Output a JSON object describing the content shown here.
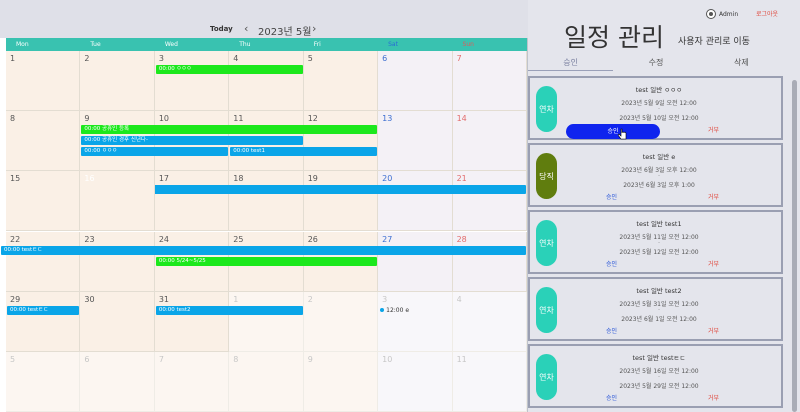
{
  "calendar": {
    "today_label": "Today",
    "prev_icon": "chevron-left",
    "next_icon": "chevron-right",
    "month_title": "2023년 5월",
    "weekdays": [
      "Mon",
      "Tue",
      "Wed",
      "Thu",
      "Fri",
      "Sat",
      "Sun"
    ],
    "weeks": [
      [
        {
          "d": "1"
        },
        {
          "d": "2"
        },
        {
          "d": "3"
        },
        {
          "d": "4"
        },
        {
          "d": "5"
        },
        {
          "d": "6"
        },
        {
          "d": "7"
        }
      ],
      [
        {
          "d": "8"
        },
        {
          "d": "9"
        },
        {
          "d": "10"
        },
        {
          "d": "11"
        },
        {
          "d": "12"
        },
        {
          "d": "13"
        },
        {
          "d": "14"
        }
      ],
      [
        {
          "d": "15"
        },
        {
          "d": "16"
        },
        {
          "d": "17"
        },
        {
          "d": "18"
        },
        {
          "d": "19"
        },
        {
          "d": "20"
        },
        {
          "d": "21"
        }
      ],
      [
        {
          "d": "22"
        },
        {
          "d": "23"
        },
        {
          "d": "24"
        },
        {
          "d": "25"
        },
        {
          "d": "26"
        },
        {
          "d": "27"
        },
        {
          "d": "28"
        }
      ],
      [
        {
          "d": "29"
        },
        {
          "d": "30"
        },
        {
          "d": "31"
        },
        {
          "d": "1",
          "other": true
        },
        {
          "d": "2",
          "other": true
        },
        {
          "d": "3",
          "other": true
        },
        {
          "d": "4",
          "other": true
        }
      ],
      [
        {
          "d": "5",
          "other": true
        },
        {
          "d": "6",
          "other": true
        },
        {
          "d": "7",
          "other": true
        },
        {
          "d": "8",
          "other": true
        },
        {
          "d": "9",
          "other": true
        },
        {
          "d": "10",
          "other": true
        },
        {
          "d": "11",
          "other": true
        }
      ]
    ],
    "today_date": "16",
    "events": [
      {
        "week": 0,
        "col": 2,
        "span": 2,
        "row": 0,
        "color": "green",
        "text": "00:00 ㅇㅇㅇ"
      },
      {
        "week": 1,
        "col": 1,
        "span": 4,
        "row": 0,
        "color": "green",
        "text": "00:00 공휴인 등록"
      },
      {
        "week": 1,
        "col": 1,
        "span": 3,
        "row": 1,
        "color": "blue",
        "text": "00:00 공휴인 경후 신년다-"
      },
      {
        "week": 1,
        "col": 1,
        "span": 2,
        "row": 2,
        "color": "blue",
        "text": "00:00 ㅇㅇㅇ"
      },
      {
        "week": 1,
        "col": 3,
        "span": 2,
        "row": 2,
        "color": "blue",
        "text": "00:00 test1"
      },
      {
        "week": 2,
        "col": 1,
        "span": 6,
        "row": 0,
        "color": "blue",
        "text": "00:00 testㅌㄷ"
      },
      {
        "week": 3,
        "col": 0,
        "span": 7,
        "row": 0,
        "color": "blue",
        "text": "00:00 testㅌㄷ"
      },
      {
        "week": 3,
        "col": 2,
        "span": 3,
        "row": 1,
        "color": "green",
        "text": "00:00 5/24~5/25"
      },
      {
        "week": 4,
        "col": 0,
        "span": 1,
        "row": 0,
        "color": "blue",
        "text": "00:00 testㅌㄷ"
      },
      {
        "week": 4,
        "col": 2,
        "span": 2,
        "row": 0,
        "color": "blue",
        "text": "00:00 test2"
      }
    ],
    "dot_event": {
      "week": 4,
      "col": 5,
      "text": "12:00 e"
    }
  },
  "panel": {
    "admin_label": "Admin",
    "logout_label": "로그아웃",
    "title": "일정 관리",
    "user_link": "사용자 관리로 이동",
    "tabs": [
      "승인",
      "수정",
      "삭제"
    ],
    "cards": [
      {
        "pill": "연차",
        "pill_color": "teal",
        "title": "test 일반 ㅇㅇㅇ",
        "start": "2023년 5월 9일 오전 12:00",
        "dash": "-",
        "end": "2023년 5월 10일 오전 12:00",
        "approve": "승인",
        "reject": "거부",
        "active": true
      },
      {
        "pill": "당직",
        "pill_color": "olive",
        "title": "test 일반 e",
        "start": "2023년 6월 3일 오후 12:00",
        "dash": "-",
        "end": "2023년 6월 3일 오후 1:00",
        "approve": "승인",
        "reject": "거부"
      },
      {
        "pill": "연차",
        "pill_color": "teal",
        "title": "test 일반 test1",
        "start": "2023년 5월 11일 오전 12:00",
        "dash": "-",
        "end": "2023년 5월 12일 오전 12:00",
        "approve": "승인",
        "reject": "거부"
      },
      {
        "pill": "연차",
        "pill_color": "teal",
        "title": "test 일반 test2",
        "start": "2023년 5월 31일 오전 12:00",
        "dash": "-",
        "end": "2023년 6월 1일 오전 12:00",
        "approve": "승인",
        "reject": "거부"
      },
      {
        "pill": "연차",
        "pill_color": "teal",
        "title": "test 일반 testㅌㄷ",
        "start": "2023년 5월 16일 오전 12:00",
        "dash": "-",
        "end": "2023년 5월 29일 오전 12:00",
        "approve": "승인",
        "reject": "거부"
      }
    ]
  }
}
